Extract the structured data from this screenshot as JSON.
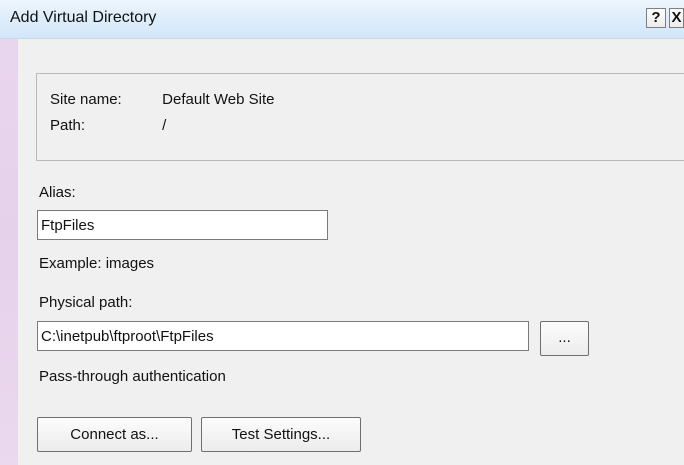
{
  "window": {
    "title": "Add Virtual Directory",
    "help_glyph": "?",
    "close_glyph": "X"
  },
  "site_info": {
    "site_name_label": "Site name:",
    "site_name_value": "Default Web Site",
    "path_label": "Path:",
    "path_value": "/"
  },
  "alias": {
    "label": "Alias:",
    "value": "FtpFiles",
    "example": "Example: images"
  },
  "physical_path": {
    "label": "Physical path:",
    "value": "C:\\inetpub\\ftproot\\FtpFiles",
    "browse_label": "..."
  },
  "authentication": {
    "text": "Pass-through authentication"
  },
  "buttons": {
    "connect_as": "Connect as...",
    "test_settings": "Test Settings..."
  },
  "colors": {
    "title_bar": "#dfeefb",
    "dialog_background": "#f0f0f0",
    "left_glass": "#e6d1ea"
  },
  "icons": {
    "help": "help-icon",
    "close": "close-icon"
  }
}
